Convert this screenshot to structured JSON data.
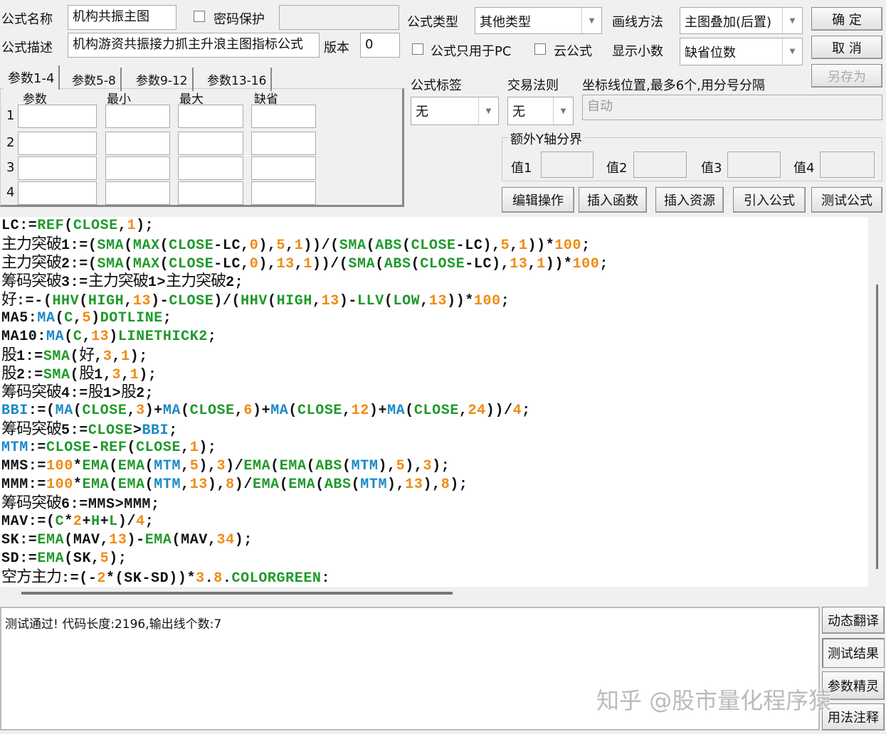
{
  "header": {
    "name_label": "公式名称",
    "name_value": "机构共振主图",
    "password_label": "密码保护",
    "password_checked": false,
    "desc_label": "公式描述",
    "desc_value": "机构游资共振接力抓主升浪主图指标公式",
    "version_label": "版本",
    "version_value": "0",
    "type_label": "公式类型",
    "type_value": "其他类型",
    "draw_label": "画线方法",
    "draw_value": "主图叠加(后置)",
    "pc_only_label": "公式只用于PC",
    "pc_only_checked": false,
    "cloud_label": "云公式",
    "cloud_checked": false,
    "decimals_label": "显示小数",
    "decimals_value": "缺省位数",
    "ok": "确  定",
    "cancel": "取  消",
    "save_as": "另存为",
    "tag_label": "公式标签",
    "tag_value": "无",
    "trade_label": "交易法则",
    "trade_value": "无",
    "axis_label": "坐标线位置,最多6个,用分号分隔",
    "axis_placeholder": "自动",
    "yaxis_group": "额外Y轴分界",
    "v1": "值1",
    "v2": "值2",
    "v3": "值3",
    "v4": "值4"
  },
  "tabs": [
    "参数1-4",
    "参数5-8",
    "参数9-12",
    "参数13-16"
  ],
  "params": {
    "headers": [
      "参数",
      "最小",
      "最大",
      "缺省"
    ],
    "rows": [
      "1",
      "2",
      "3",
      "4"
    ]
  },
  "toolbar": [
    "编辑操作",
    "插入函数",
    "插入资源",
    "引入公式",
    "测试公式"
  ],
  "code": [
    [
      [
        "k",
        "LC:="
      ],
      [
        "f",
        "REF"
      ],
      [
        "k",
        "("
      ],
      [
        "f",
        "CLOSE"
      ],
      [
        "k",
        ","
      ],
      [
        "n",
        "1"
      ],
      [
        "k",
        ");"
      ]
    ],
    [
      [
        "k",
        "主力突破"
      ],
      [
        "k",
        "1:=("
      ],
      [
        "f",
        "SMA"
      ],
      [
        "k",
        "("
      ],
      [
        "f",
        "MAX"
      ],
      [
        "k",
        "("
      ],
      [
        "f",
        "CLOSE"
      ],
      [
        "k",
        "-LC,"
      ],
      [
        "n",
        "0"
      ],
      [
        "k",
        "),"
      ],
      [
        "n",
        "5"
      ],
      [
        "k",
        ","
      ],
      [
        "n",
        "1"
      ],
      [
        "k",
        "))/("
      ],
      [
        "f",
        "SMA"
      ],
      [
        "k",
        "("
      ],
      [
        "f",
        "ABS"
      ],
      [
        "k",
        "("
      ],
      [
        "f",
        "CLOSE"
      ],
      [
        "k",
        "-LC),"
      ],
      [
        "n",
        "5"
      ],
      [
        "k",
        ","
      ],
      [
        "n",
        "1"
      ],
      [
        "k",
        "))*"
      ],
      [
        "n",
        "100"
      ],
      [
        "k",
        ";"
      ]
    ],
    [
      [
        "k",
        "主力突破"
      ],
      [
        "k",
        "2:=("
      ],
      [
        "f",
        "SMA"
      ],
      [
        "k",
        "("
      ],
      [
        "f",
        "MAX"
      ],
      [
        "k",
        "("
      ],
      [
        "f",
        "CLOSE"
      ],
      [
        "k",
        "-LC,"
      ],
      [
        "n",
        "0"
      ],
      [
        "k",
        "),"
      ],
      [
        "n",
        "13"
      ],
      [
        "k",
        ","
      ],
      [
        "n",
        "1"
      ],
      [
        "k",
        "))/("
      ],
      [
        "f",
        "SMA"
      ],
      [
        "k",
        "("
      ],
      [
        "f",
        "ABS"
      ],
      [
        "k",
        "("
      ],
      [
        "f",
        "CLOSE"
      ],
      [
        "k",
        "-LC),"
      ],
      [
        "n",
        "13"
      ],
      [
        "k",
        ","
      ],
      [
        "n",
        "1"
      ],
      [
        "k",
        "))*"
      ],
      [
        "n",
        "100"
      ],
      [
        "k",
        ";"
      ]
    ],
    [
      [
        "k",
        "筹码突破"
      ],
      [
        "k",
        "3:="
      ],
      [
        "k",
        "主力突破"
      ],
      [
        "k",
        "1>"
      ],
      [
        "k",
        "主力突破"
      ],
      [
        "k",
        "2;"
      ]
    ],
    [
      [
        "k",
        "好"
      ],
      [
        "k",
        ":=-("
      ],
      [
        "f",
        "HHV"
      ],
      [
        "k",
        "("
      ],
      [
        "f",
        "HIGH"
      ],
      [
        "k",
        ","
      ],
      [
        "n",
        "13"
      ],
      [
        "k",
        ")-"
      ],
      [
        "f",
        "CLOSE"
      ],
      [
        "k",
        ")/("
      ],
      [
        "f",
        "HHV"
      ],
      [
        "k",
        "("
      ],
      [
        "f",
        "HIGH"
      ],
      [
        "k",
        ","
      ],
      [
        "n",
        "13"
      ],
      [
        "k",
        ")-"
      ],
      [
        "f",
        "LLV"
      ],
      [
        "k",
        "("
      ],
      [
        "f",
        "LOW"
      ],
      [
        "k",
        ","
      ],
      [
        "n",
        "13"
      ],
      [
        "k",
        "))*"
      ],
      [
        "n",
        "100"
      ],
      [
        "k",
        ";"
      ]
    ],
    [
      [
        "k",
        "MA5:"
      ],
      [
        "b",
        "MA"
      ],
      [
        "k",
        "("
      ],
      [
        "f",
        "C"
      ],
      [
        "k",
        ","
      ],
      [
        "n",
        "5"
      ],
      [
        "k",
        ")"
      ],
      [
        "f",
        "DOTLINE"
      ],
      [
        "k",
        ";"
      ]
    ],
    [
      [
        "k",
        "MA10:"
      ],
      [
        "b",
        "MA"
      ],
      [
        "k",
        "("
      ],
      [
        "f",
        "C"
      ],
      [
        "k",
        ","
      ],
      [
        "n",
        "13"
      ],
      [
        "k",
        ")"
      ],
      [
        "f",
        "LINETHICK2"
      ],
      [
        "k",
        ";"
      ]
    ],
    [
      [
        "k",
        "股"
      ],
      [
        "k",
        "1:="
      ],
      [
        "f",
        "SMA"
      ],
      [
        "k",
        "("
      ],
      [
        "k",
        "好"
      ],
      [
        "k",
        ","
      ],
      [
        "n",
        "3"
      ],
      [
        "k",
        ","
      ],
      [
        "n",
        "1"
      ],
      [
        "k",
        ");"
      ]
    ],
    [
      [
        "k",
        "股"
      ],
      [
        "k",
        "2:="
      ],
      [
        "f",
        "SMA"
      ],
      [
        "k",
        "("
      ],
      [
        "k",
        "股"
      ],
      [
        "k",
        "1,"
      ],
      [
        "n",
        "3"
      ],
      [
        "k",
        ","
      ],
      [
        "n",
        "1"
      ],
      [
        "k",
        ");"
      ]
    ],
    [
      [
        "k",
        "筹码突破"
      ],
      [
        "k",
        "4:="
      ],
      [
        "k",
        "股"
      ],
      [
        "k",
        "1>"
      ],
      [
        "k",
        "股"
      ],
      [
        "k",
        "2;"
      ]
    ],
    [
      [
        "b",
        "BBI"
      ],
      [
        "k",
        ":=("
      ],
      [
        "b",
        "MA"
      ],
      [
        "k",
        "("
      ],
      [
        "f",
        "CLOSE"
      ],
      [
        "k",
        ","
      ],
      [
        "n",
        "3"
      ],
      [
        "k",
        ")+"
      ],
      [
        "b",
        "MA"
      ],
      [
        "k",
        "("
      ],
      [
        "f",
        "CLOSE"
      ],
      [
        "k",
        ","
      ],
      [
        "n",
        "6"
      ],
      [
        "k",
        ")+"
      ],
      [
        "b",
        "MA"
      ],
      [
        "k",
        "("
      ],
      [
        "f",
        "CLOSE"
      ],
      [
        "k",
        ","
      ],
      [
        "n",
        "12"
      ],
      [
        "k",
        ")+"
      ],
      [
        "b",
        "MA"
      ],
      [
        "k",
        "("
      ],
      [
        "f",
        "CLOSE"
      ],
      [
        "k",
        ","
      ],
      [
        "n",
        "24"
      ],
      [
        "k",
        "))/"
      ],
      [
        "n",
        "4"
      ],
      [
        "k",
        ";"
      ]
    ],
    [
      [
        "k",
        "筹码突破"
      ],
      [
        "k",
        "5:="
      ],
      [
        "f",
        "CLOSE"
      ],
      [
        "k",
        ">"
      ],
      [
        "b",
        "BBI"
      ],
      [
        "k",
        ";"
      ]
    ],
    [
      [
        "b",
        "MTM"
      ],
      [
        "k",
        ":="
      ],
      [
        "f",
        "CLOSE"
      ],
      [
        "k",
        "-"
      ],
      [
        "f",
        "REF"
      ],
      [
        "k",
        "("
      ],
      [
        "f",
        "CLOSE"
      ],
      [
        "k",
        ","
      ],
      [
        "n",
        "1"
      ],
      [
        "k",
        ");"
      ]
    ],
    [
      [
        "k",
        "MMS:="
      ],
      [
        "n",
        "100"
      ],
      [
        "k",
        "*"
      ],
      [
        "f",
        "EMA"
      ],
      [
        "k",
        "("
      ],
      [
        "f",
        "EMA"
      ],
      [
        "k",
        "("
      ],
      [
        "b",
        "MTM"
      ],
      [
        "k",
        ","
      ],
      [
        "n",
        "5"
      ],
      [
        "k",
        "),"
      ],
      [
        "n",
        "3"
      ],
      [
        "k",
        ")/"
      ],
      [
        "f",
        "EMA"
      ],
      [
        "k",
        "("
      ],
      [
        "f",
        "EMA"
      ],
      [
        "k",
        "("
      ],
      [
        "f",
        "ABS"
      ],
      [
        "k",
        "("
      ],
      [
        "b",
        "MTM"
      ],
      [
        "k",
        "),"
      ],
      [
        "n",
        "5"
      ],
      [
        "k",
        "),"
      ],
      [
        "n",
        "3"
      ],
      [
        "k",
        ");"
      ]
    ],
    [
      [
        "k",
        "MMM:="
      ],
      [
        "n",
        "100"
      ],
      [
        "k",
        "*"
      ],
      [
        "f",
        "EMA"
      ],
      [
        "k",
        "("
      ],
      [
        "f",
        "EMA"
      ],
      [
        "k",
        "("
      ],
      [
        "b",
        "MTM"
      ],
      [
        "k",
        ","
      ],
      [
        "n",
        "13"
      ],
      [
        "k",
        "),"
      ],
      [
        "n",
        "8"
      ],
      [
        "k",
        ")/"
      ],
      [
        "f",
        "EMA"
      ],
      [
        "k",
        "("
      ],
      [
        "f",
        "EMA"
      ],
      [
        "k",
        "("
      ],
      [
        "f",
        "ABS"
      ],
      [
        "k",
        "("
      ],
      [
        "b",
        "MTM"
      ],
      [
        "k",
        "),"
      ],
      [
        "n",
        "13"
      ],
      [
        "k",
        "),"
      ],
      [
        "n",
        "8"
      ],
      [
        "k",
        ");"
      ]
    ],
    [
      [
        "k",
        "筹码突破"
      ],
      [
        "k",
        "6:=MMS>MMM;"
      ]
    ],
    [
      [
        "k",
        "MAV:=("
      ],
      [
        "f",
        "C"
      ],
      [
        "k",
        "*"
      ],
      [
        "n",
        "2"
      ],
      [
        "k",
        "+"
      ],
      [
        "f",
        "H"
      ],
      [
        "k",
        "+"
      ],
      [
        "f",
        "L"
      ],
      [
        "k",
        ")/"
      ],
      [
        "n",
        "4"
      ],
      [
        "k",
        ";"
      ]
    ],
    [
      [
        "k",
        "SK:="
      ],
      [
        "f",
        "EMA"
      ],
      [
        "k",
        "(MAV,"
      ],
      [
        "n",
        "13"
      ],
      [
        "k",
        ")-"
      ],
      [
        "f",
        "EMA"
      ],
      [
        "k",
        "(MAV,"
      ],
      [
        "n",
        "34"
      ],
      [
        "k",
        ");"
      ]
    ],
    [
      [
        "k",
        "SD:="
      ],
      [
        "f",
        "EMA"
      ],
      [
        "k",
        "(SK,"
      ],
      [
        "n",
        "5"
      ],
      [
        "k",
        ");"
      ]
    ],
    [
      [
        "k",
        "空方主力"
      ],
      [
        "k",
        ":=(-"
      ],
      [
        "n",
        "2"
      ],
      [
        "k",
        "*(SK-SD))*"
      ],
      [
        "n",
        "3"
      ],
      [
        "k",
        "."
      ],
      [
        "n",
        "8"
      ],
      [
        "k",
        "."
      ],
      [
        "f",
        "COLORGREEN"
      ],
      [
        "k",
        ":"
      ]
    ]
  ],
  "output": {
    "text": "测试通过! 代码长度:2196,输出线个数:7"
  },
  "side_buttons": [
    "动态翻译",
    "测试结果",
    "参数精灵",
    "用法注释"
  ],
  "watermark": "知乎 @股市量化程序猿",
  "colors": {
    "function": "#1e9a2a",
    "number": "#f08a10",
    "variable": "#1a88c8"
  }
}
